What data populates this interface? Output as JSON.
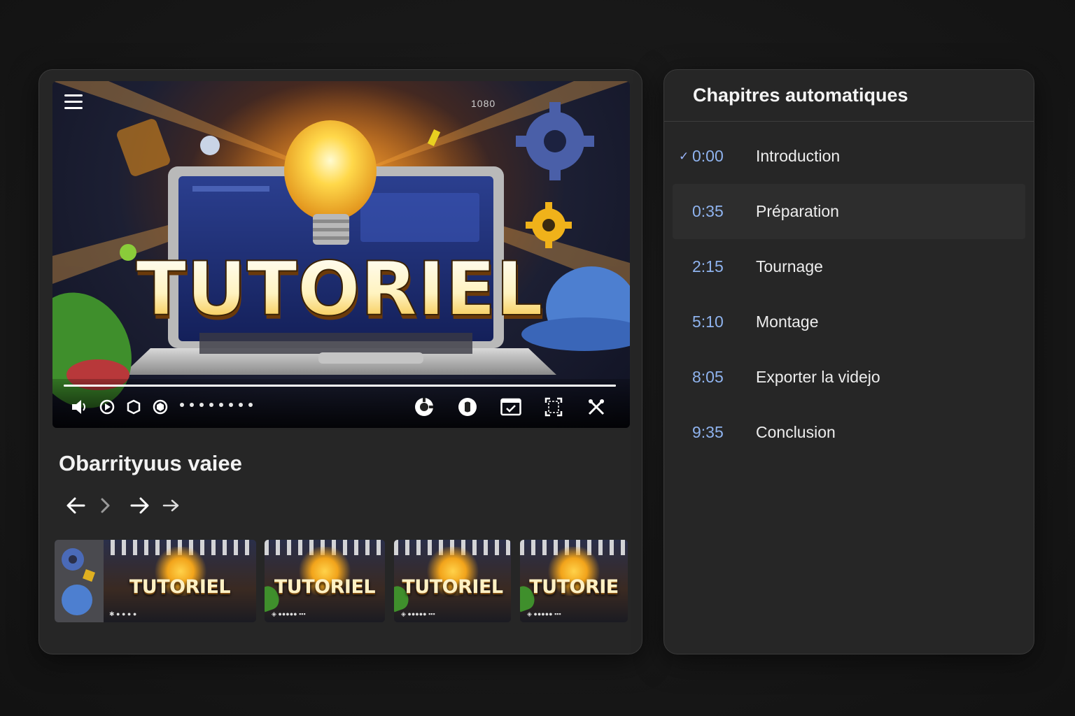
{
  "player": {
    "quality_badge": "1080",
    "thumbnail_word": "TUTORIEL",
    "progress_fraction": 1.0,
    "control_icons": [
      "volume-icon",
      "play-icon",
      "camera-icon",
      "loop-icon",
      "settings-icon",
      "cc-icon",
      "miniplayer-icon",
      "fullscreen-icon",
      "tools-icon"
    ]
  },
  "video": {
    "title": "Obarrityuus vaiee"
  },
  "thumbnails": [
    {
      "word": "TUTORIEL",
      "caption": "✱ ● ● ● ●"
    },
    {
      "word": "TUTORIEL",
      "caption": "◈ ●●●●● ▪▪▪"
    },
    {
      "word": "TUTORIEL",
      "caption": "◈ ●●●●● ▪▪▪"
    },
    {
      "word": "TUTORIE",
      "caption": "◈ ●●●●● ▪▪▪"
    }
  ],
  "chapters": {
    "title": "Chapitres automatiques",
    "items": [
      {
        "time": "0:00",
        "label": "Introduction",
        "current": true
      },
      {
        "time": "0:35",
        "label": "Préparation",
        "current": false
      },
      {
        "time": "2:15",
        "label": "Tournage",
        "current": false
      },
      {
        "time": "5:10",
        "label": "Montage",
        "current": false
      },
      {
        "time": "8:05",
        "label": "Exporter la videjo",
        "current": false
      },
      {
        "time": "9:35",
        "label": "Conclusion",
        "current": false
      }
    ]
  },
  "colors": {
    "accent_time": "#8fb3ee",
    "panel_bg": "#262626",
    "page_bg": "#161616"
  }
}
